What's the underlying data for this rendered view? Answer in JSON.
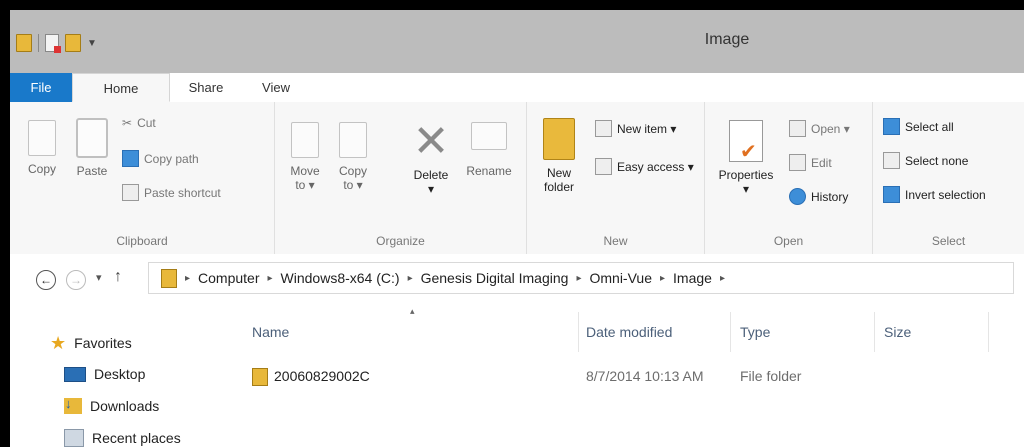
{
  "window": {
    "title": "Image"
  },
  "tabs": {
    "file": "File",
    "home": "Home",
    "share": "Share",
    "view": "View"
  },
  "ribbon": {
    "clipboard": {
      "label": "Clipboard",
      "copy": "Copy",
      "paste": "Paste",
      "cut": "Cut",
      "copy_path": "Copy path",
      "paste_shortcut": "Paste shortcut"
    },
    "organize": {
      "label": "Organize",
      "move_to": "Move",
      "move_to_2": "to ▾",
      "copy_to": "Copy",
      "copy_to_2": "to ▾",
      "delete": "Delete",
      "delete_arrow": "▾",
      "rename": "Rename"
    },
    "new": {
      "label": "New",
      "new_folder": "New",
      "new_folder_2": "folder",
      "new_item": "New item ▾",
      "easy_access": "Easy access ▾"
    },
    "open": {
      "label": "Open",
      "properties": "Properties",
      "properties_arrow": "▾",
      "open": "Open ▾",
      "edit": "Edit",
      "history": "History"
    },
    "select": {
      "label": "Select",
      "select_all": "Select all",
      "select_none": "Select none",
      "invert": "Invert selection"
    }
  },
  "address": {
    "nav": {
      "back": "←",
      "forward": "→",
      "recent": "▾",
      "up": "↑"
    },
    "chevron": "▸",
    "crumbs": [
      "Computer",
      "Windows8-x64 (C:)",
      "Genesis Digital Imaging",
      "Omni-Vue",
      "Image"
    ]
  },
  "nav_pane": {
    "favorites": "Favorites",
    "items": [
      "Desktop",
      "Downloads",
      "Recent places"
    ]
  },
  "file_list": {
    "sort_indicator": "▴",
    "columns": {
      "name": "Name",
      "date": "Date modified",
      "type": "Type",
      "size": "Size"
    },
    "rows": [
      {
        "name": "20060829002C",
        "date": "8/7/2014 10:13 AM",
        "type": "File folder",
        "size": ""
      }
    ]
  }
}
